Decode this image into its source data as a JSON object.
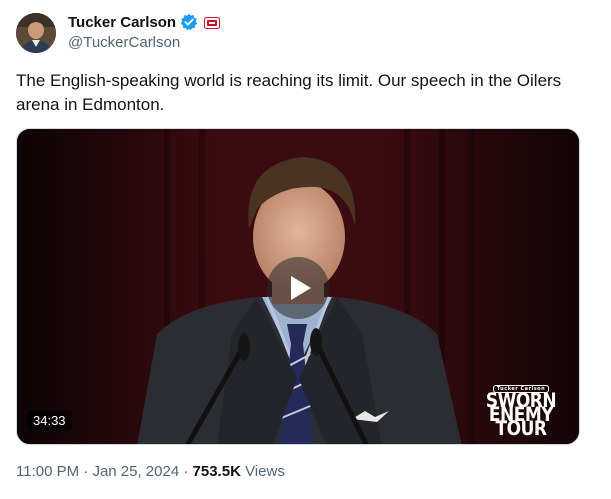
{
  "author": {
    "display_name": "Tucker Carlson",
    "handle": "@TuckerCarlson",
    "avatar_icon": "profile-photo",
    "verified_icon": "verified-badge-icon",
    "affiliation_icon": "affiliation-badge-icon"
  },
  "tweet": {
    "text": "The English-speaking world is reaching its limit. Our speech in the Oilers arena in Edmonton."
  },
  "video": {
    "duration": "34:33",
    "play_icon": "play-icon",
    "overlay_logo": {
      "small": "Tucker Carlson",
      "line1": "SWORN",
      "line2": "ENEMY",
      "line3": "TOUR"
    }
  },
  "meta": {
    "time": "11:00 PM",
    "separator": " · ",
    "date": "Jan 25, 2024",
    "views_count": "753.5K",
    "views_label": " Views"
  },
  "colors": {
    "verified_blue": "#1d9bf0",
    "secondary_text": "#536471",
    "primary_text": "#0f1419"
  }
}
